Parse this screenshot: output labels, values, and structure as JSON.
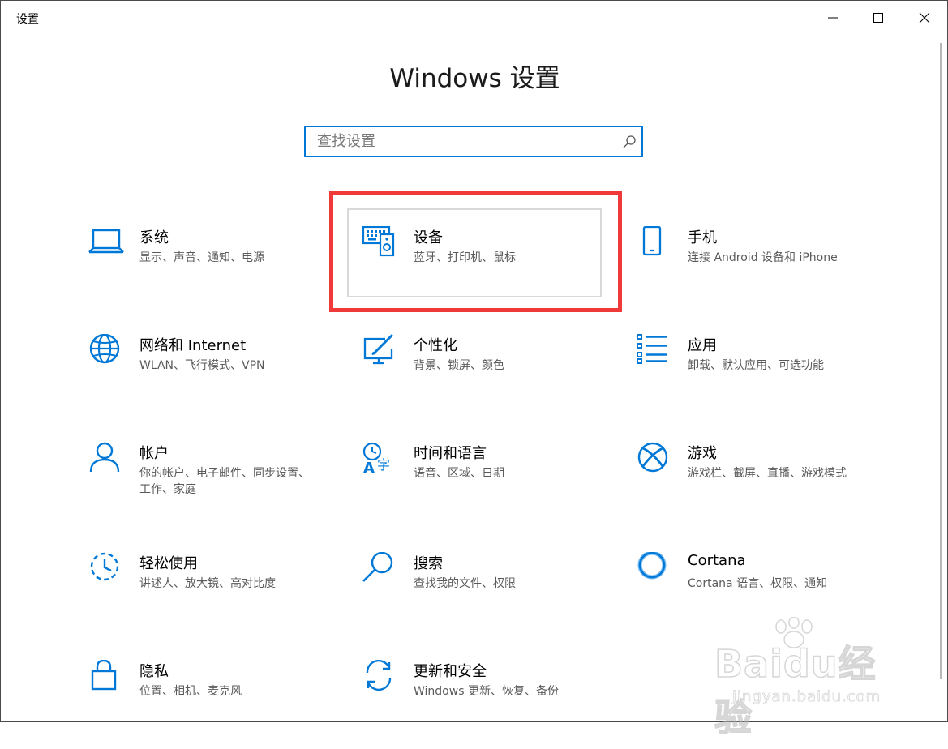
{
  "window": {
    "title": "设置",
    "minimize": "—",
    "maximize": "☐",
    "close": "✕"
  },
  "page": {
    "title": "Windows 设置"
  },
  "search": {
    "placeholder": "查找设置",
    "value": ""
  },
  "colors": {
    "accent": "#0078d7",
    "highlight": "#f03a3a"
  },
  "tiles": [
    {
      "label": "系统",
      "desc": "显示、声音、通知、电源",
      "icon": "laptop-icon"
    },
    {
      "label": "设备",
      "desc": "蓝牙、打印机、鼠标",
      "icon": "devices-icon"
    },
    {
      "label": "手机",
      "desc": "连接 Android 设备和 iPhone",
      "icon": "phone-icon"
    },
    {
      "label": "网络和 Internet",
      "desc": "WLAN、飞行模式、VPN",
      "icon": "globe-icon"
    },
    {
      "label": "个性化",
      "desc": "背景、锁屏、颜色",
      "icon": "personalize-icon"
    },
    {
      "label": "应用",
      "desc": "卸载、默认应用、可选功能",
      "icon": "apps-list-icon"
    },
    {
      "label": "帐户",
      "desc": "你的帐户、电子邮件、同步设置、工作、家庭",
      "icon": "person-icon"
    },
    {
      "label": "时间和语言",
      "desc": "语音、区域、日期",
      "icon": "time-language-icon"
    },
    {
      "label": "游戏",
      "desc": "游戏栏、截屏、直播、游戏模式",
      "icon": "xbox-icon"
    },
    {
      "label": "轻松使用",
      "desc": "讲述人、放大镜、高对比度",
      "icon": "ease-of-access-icon"
    },
    {
      "label": "搜索",
      "desc": "查找我的文件、权限",
      "icon": "magnifier-icon"
    },
    {
      "label": "Cortana",
      "desc": "Cortana 语言、权限、通知",
      "icon": "cortana-icon"
    },
    {
      "label": "隐私",
      "desc": "位置、相机、麦克风",
      "icon": "lock-icon"
    },
    {
      "label": "更新和安全",
      "desc": "Windows 更新、恢复、备份",
      "icon": "sync-icon"
    }
  ],
  "watermark": {
    "logo": "Baidu经验",
    "url": "jingyan.baidu.com"
  }
}
